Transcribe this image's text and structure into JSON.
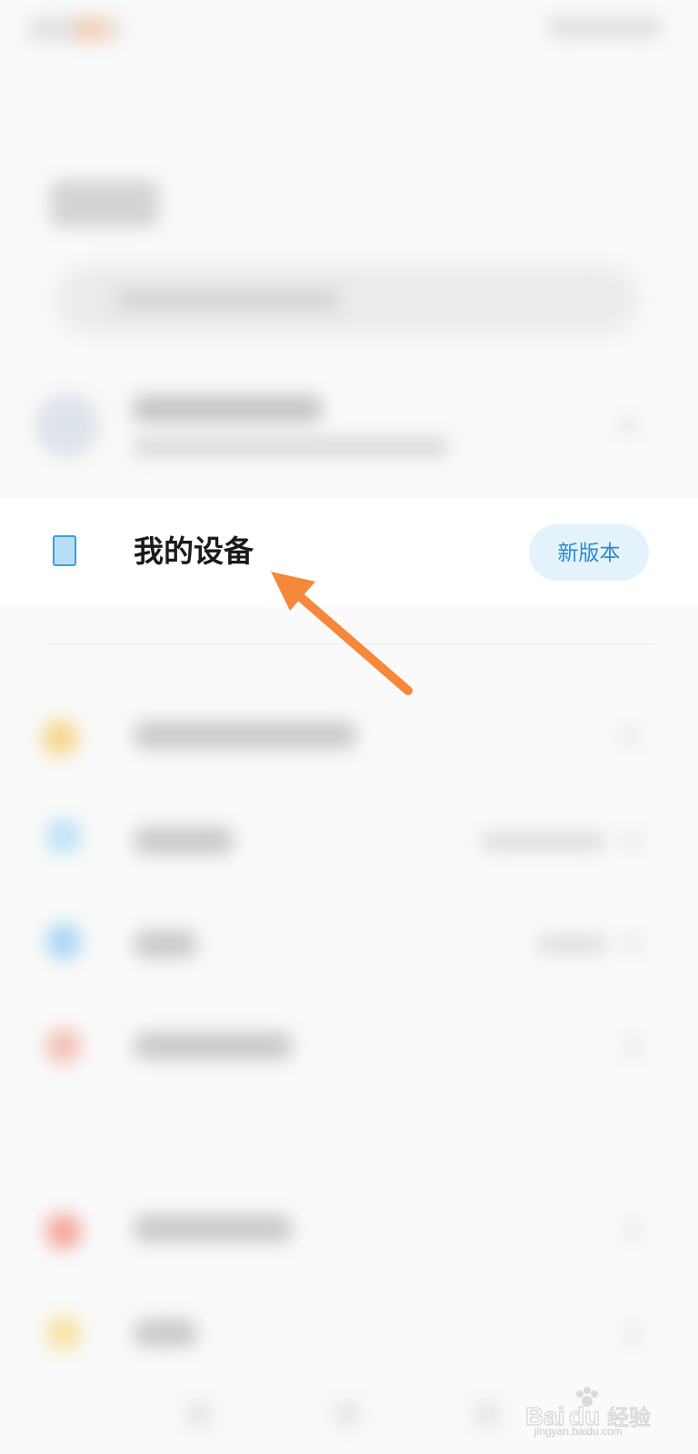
{
  "device_row": {
    "label": "我的设备",
    "badge": "新版本"
  },
  "icons": {
    "device": "tablet-device-icon",
    "arrow": "annotation-arrow-icon"
  },
  "colors": {
    "accent": "#2b8ad1",
    "badge_bg": "#e4f2fb",
    "icon_fill": "#b9def8",
    "arrow": "#f5883a"
  },
  "watermark": {
    "brand": "Baidu经验",
    "url": "jingyan.baidu.com"
  }
}
